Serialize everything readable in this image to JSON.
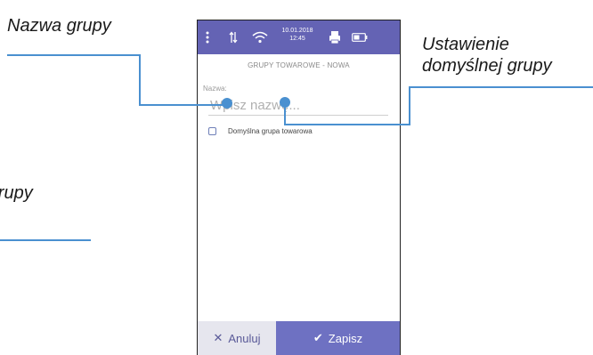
{
  "callouts": {
    "group_name": "Nazwa grupy",
    "default_group_line1": "Ustawienie",
    "default_group_line2": "domyślnej grupy",
    "partial_group": "a grupy"
  },
  "status_bar": {
    "date": "10.01.2018",
    "time": "12:45",
    "icons": [
      "menu-dots-icon",
      "data-transfer-icon",
      "wifi-icon",
      "printer-icon",
      "battery-icon"
    ]
  },
  "form": {
    "title": "GRUPY TOWAROWE - NOWA",
    "name_label": "Nazwa:",
    "name_placeholder": "Wpisz nazwę...",
    "name_value": "",
    "default_group_label": "Domyślna grupa towarowa",
    "default_group_checked": false
  },
  "actions": {
    "cancel_label": "Anuluj",
    "save_label": "Zapisz"
  },
  "colors": {
    "status_bar": "#6463b4",
    "accent": "#6e71c2",
    "leader_line": "#4a90d0"
  }
}
